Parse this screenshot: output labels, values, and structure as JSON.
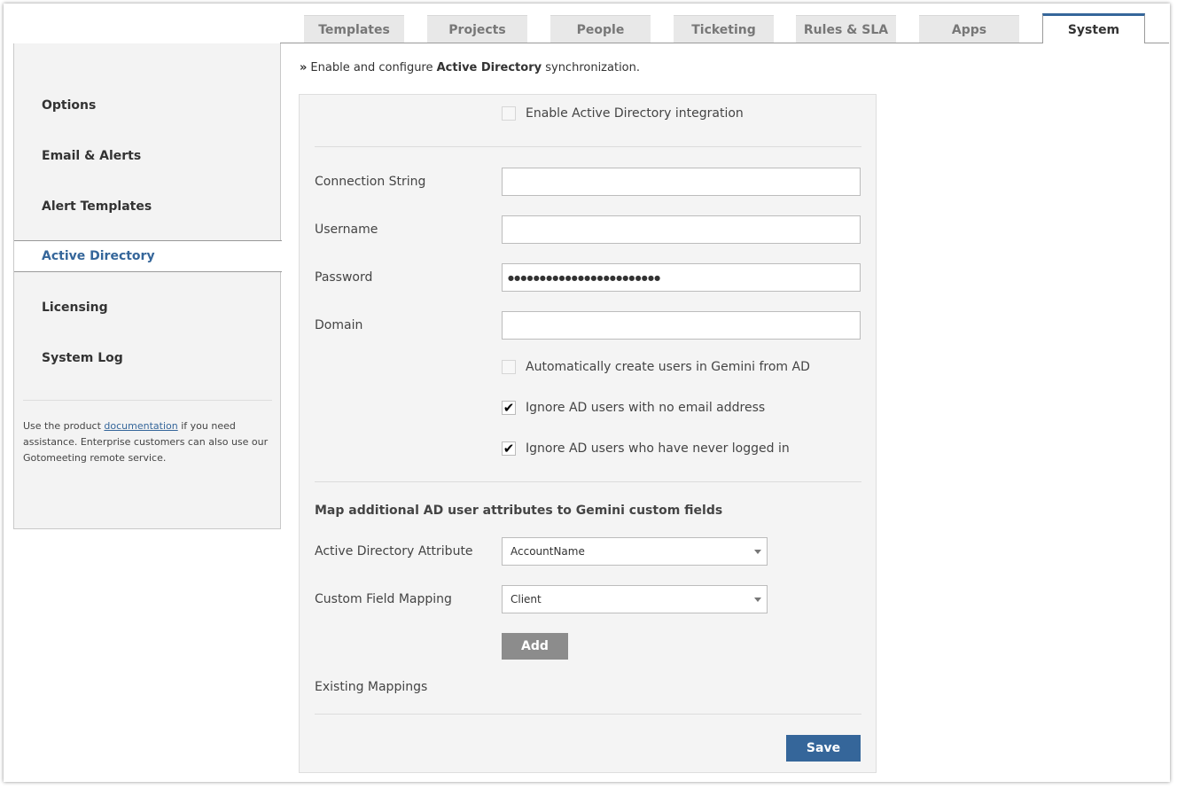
{
  "tabs": [
    {
      "label": "Templates",
      "active": false
    },
    {
      "label": "Projects",
      "active": false
    },
    {
      "label": "People",
      "active": false
    },
    {
      "label": "Ticketing",
      "active": false
    },
    {
      "label": "Rules & SLA",
      "active": false
    },
    {
      "label": "Apps",
      "active": false
    },
    {
      "label": "System",
      "active": true
    }
  ],
  "sidebar": {
    "items": [
      {
        "label": "Options"
      },
      {
        "label": "Email & Alerts"
      },
      {
        "label": "Alert Templates"
      },
      {
        "label": "Active Directory",
        "active": true
      },
      {
        "label": "Licensing"
      },
      {
        "label": "System Log"
      }
    ],
    "help": {
      "before": "Use the product ",
      "link": "documentation",
      "after": " if you need assistance. Enterprise customers can also use our Gotomeeting remote service."
    }
  },
  "intro": {
    "arrow": "»",
    "before": "Enable and configure ",
    "bold": "Active Directory",
    "after": " synchronization."
  },
  "form": {
    "enable_label": "Enable Active Directory integration",
    "enable_checked": false,
    "connection_label": "Connection String",
    "connection_value": "",
    "username_label": "Username",
    "username_value": "",
    "password_label": "Password",
    "password_value": "●●●●●●●●●●●●●●●●●●●●●●●●",
    "domain_label": "Domain",
    "domain_value": "",
    "auto_create_label": "Automatically create users in Gemini from AD",
    "auto_create_checked": false,
    "ignore_no_email_label": "Ignore AD users with no email address",
    "ignore_no_email_checked": true,
    "ignore_never_logged_label": "Ignore AD users who have never logged in",
    "ignore_never_logged_checked": true,
    "check_mark": "✔"
  },
  "mapping": {
    "title": "Map additional AD user attributes to Gemini custom fields",
    "attr_label": "Active Directory Attribute",
    "attr_value": "AccountName",
    "field_label": "Custom Field Mapping",
    "field_value": "Client",
    "add_label": "Add",
    "existing_label": "Existing Mappings"
  },
  "save_label": "Save",
  "colors": {
    "accent": "#35669a",
    "panel": "#f4f4f4",
    "add_button": "#8c8c8c"
  }
}
